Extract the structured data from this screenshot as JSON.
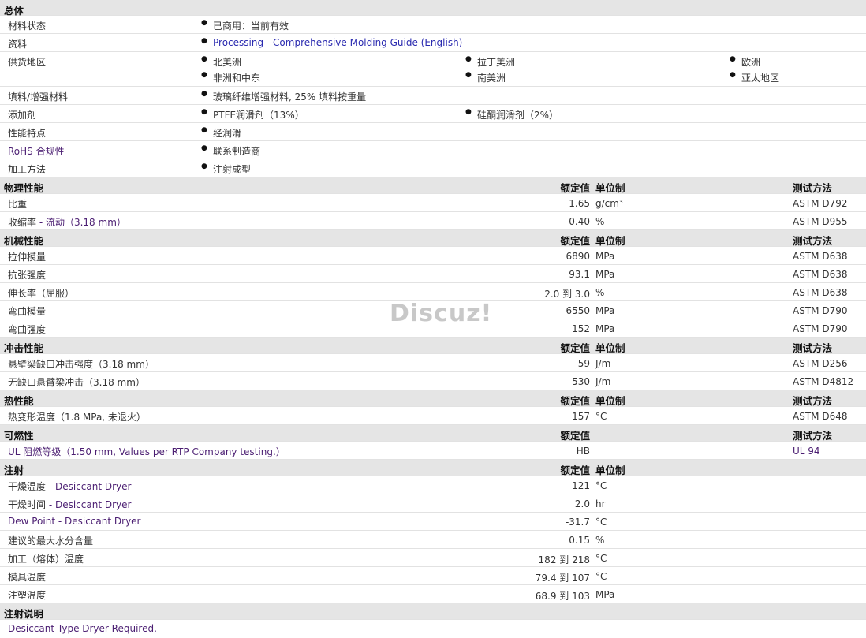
{
  "general": {
    "title": "总体",
    "material_status": {
      "label": "材料状态",
      "value": "已商用：当前有效"
    },
    "docs": {
      "label": "资料",
      "sup": "1",
      "link": "Processing - Comprehensive Molding Guide (English)"
    },
    "regions": {
      "label": "供货地区",
      "items": [
        "北美洲",
        "拉丁美洲",
        "欧洲",
        "非洲和中东",
        "南美洲",
        "亚太地区"
      ]
    },
    "filler": {
      "label": "填料/增强材料",
      "value": "玻璃纤维增强材料, 25% 填料按重量"
    },
    "additive": {
      "label": "添加剂",
      "items": [
        "PTFE润滑剂（13%）",
        "硅酮润滑剂（2%）"
      ]
    },
    "features": {
      "label": "性能特点",
      "value": "经润滑"
    },
    "rohs": {
      "label": "RoHS 合规性",
      "value": "联系制造商"
    },
    "process": {
      "label": "加工方法",
      "value": "注射成型"
    }
  },
  "physical": {
    "title": "物理性能",
    "rated": "额定值",
    "unit": "单位制",
    "method": "测试方法",
    "rows": [
      {
        "label": "比重",
        "sub": "",
        "value": "1.65",
        "unit": "g/cm³",
        "method": "ASTM D792"
      },
      {
        "label": "收缩率",
        "sub": " - 流动（3.18 mm）",
        "value": "0.40",
        "unit": "%",
        "method": "ASTM D955"
      }
    ]
  },
  "mechanical": {
    "title": "机械性能",
    "rated": "额定值",
    "unit": "单位制",
    "method": "测试方法",
    "rows": [
      {
        "label": "拉伸模量",
        "sub": "",
        "value": "6890",
        "unit": "MPa",
        "method": "ASTM D638"
      },
      {
        "label": "抗张强度",
        "sub": "",
        "value": "93.1",
        "unit": "MPa",
        "method": "ASTM D638"
      },
      {
        "label": "伸长率（屈服）",
        "sub": "",
        "value": "2.0 到  3.0",
        "unit": "%",
        "method": "ASTM D638"
      },
      {
        "label": "弯曲模量",
        "sub": "",
        "value": "6550",
        "unit": "MPa",
        "method": "ASTM D790"
      },
      {
        "label": "弯曲强度",
        "sub": "",
        "value": "152",
        "unit": "MPa",
        "method": "ASTM D790"
      }
    ]
  },
  "impact": {
    "title": "冲击性能",
    "rated": "额定值",
    "unit": "单位制",
    "method": "测试方法",
    "rows": [
      {
        "label": "悬壁梁缺口冲击强度（3.18 mm）",
        "sub": "",
        "value": "59",
        "unit": "J/m",
        "method": "ASTM D256"
      },
      {
        "label": "无缺口悬臂梁冲击（3.18 mm）",
        "sub": "",
        "value": "530",
        "unit": "J/m",
        "method": "ASTM D4812"
      }
    ]
  },
  "thermal": {
    "title": "热性能",
    "rated": "额定值",
    "unit": "单位制",
    "method": "测试方法",
    "rows": [
      {
        "label": "热变形温度（1.8 MPa, 未退火）",
        "sub": "",
        "value": "157",
        "unit": "°C",
        "method": "ASTM D648"
      }
    ]
  },
  "flammability": {
    "title": "可燃性",
    "rated": "额定值",
    "method": "测试方法",
    "rows": [
      {
        "label": "UL 阻燃等级（1.50 mm, Values per RTP Company testing.）",
        "value": "HB",
        "method": "UL 94"
      }
    ]
  },
  "injection": {
    "title": "注射",
    "rated": "额定值",
    "unit": "单位制",
    "rows": [
      {
        "label": "干燥温度",
        "sub": " - Desiccant Dryer",
        "value": "121",
        "unit": "°C",
        "purple": false
      },
      {
        "label": "干燥时间",
        "sub": " - Desiccant Dryer",
        "value": "2.0",
        "unit": "hr",
        "purple": false
      },
      {
        "label": "Dew Point - Desiccant Dryer",
        "sub": "",
        "value": "-31.7",
        "unit": "°C",
        "purple": true
      },
      {
        "label": "建议的最大水分含量",
        "sub": "",
        "value": "0.15",
        "unit": "%",
        "purple": false
      },
      {
        "label": "加工（熔体）温度",
        "sub": "",
        "value": "182 到  218",
        "unit": "°C",
        "purple": false
      },
      {
        "label": "模具温度",
        "sub": "",
        "value": "79.4 到  107",
        "unit": "°C",
        "purple": false
      },
      {
        "label": "注塑温度",
        "sub": "",
        "value": "68.9 到  103",
        "unit": "MPa",
        "purple": false
      }
    ]
  },
  "notes": {
    "title": "注射说明",
    "text": "Desiccant Type Dryer Required."
  },
  "watermark": "Discuz!"
}
